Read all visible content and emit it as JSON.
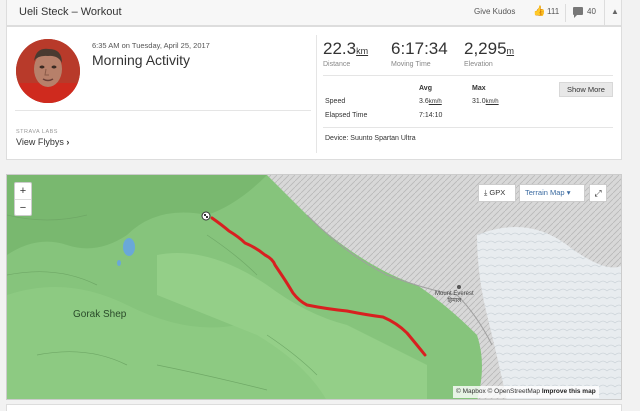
{
  "header": {
    "title": "Ueli Steck – Workout",
    "kudos_label": "Give Kudos",
    "kudos_count": "111",
    "comments_count": "40"
  },
  "summary": {
    "date": "6:35 AM on Tuesday, April 25, 2017",
    "activity_name": "Morning Activity",
    "labs_label": "STRAVA LABS",
    "flybys_label": "View Flybys"
  },
  "stats": {
    "distance": {
      "value": "22.3",
      "unit": "km",
      "label": "Distance"
    },
    "moving_time": {
      "value": "6:17:34",
      "label": "Moving Time"
    },
    "elevation": {
      "value": "2,295",
      "unit": "m",
      "label": "Elevation"
    }
  },
  "details": {
    "avg_header": "Avg",
    "max_header": "Max",
    "speed_label": "Speed",
    "speed_avg": "3.6",
    "speed_max": "31.0",
    "speed_unit": "km/h",
    "elapsed_label": "Elapsed Time",
    "elapsed_value": "7:14:10",
    "show_more": "Show More",
    "device": "Device: Suunto Spartan Ultra"
  },
  "map": {
    "gpx_label": "GPX",
    "terrain_label": "Terrain Map",
    "place_label": "Gorak Shep",
    "peak_line1": "Mount Everest",
    "peak_line2": "हिमाल",
    "attribution_mapbox": "© Mapbox",
    "attribution_osm": "© OpenStreetMap",
    "attribution_improve": "Improve this map",
    "route_color": "#d82020",
    "zoom_in": "+",
    "zoom_out": "−"
  }
}
